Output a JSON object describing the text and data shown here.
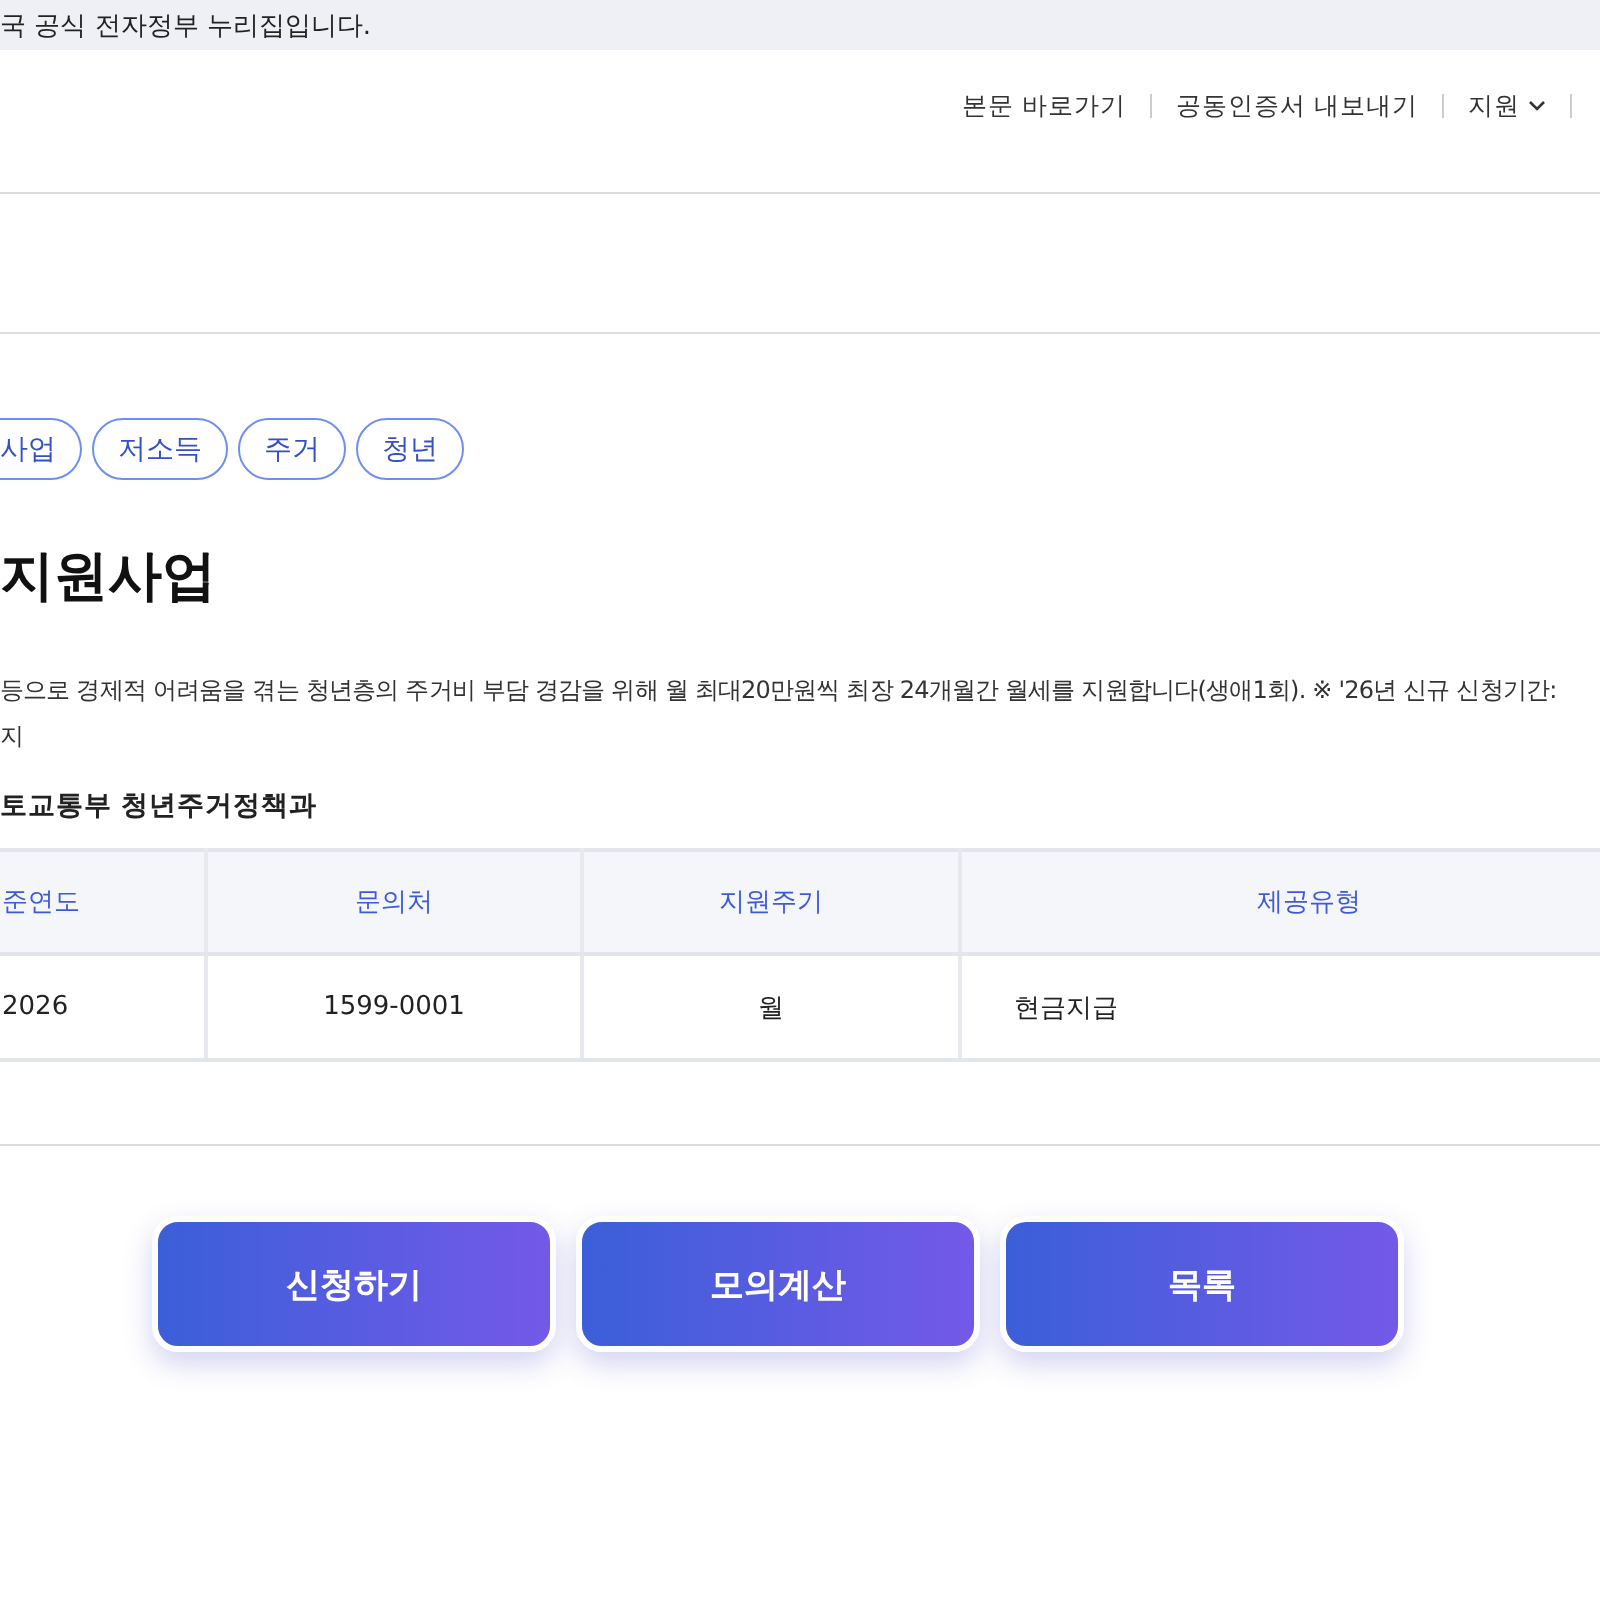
{
  "banner": {
    "text": "국 공식 전자정부 누리집입니다."
  },
  "utility_nav": [
    {
      "label": "본문 바로가기",
      "kind": "link"
    },
    {
      "label": "공동인증서 내보내기",
      "kind": "link"
    },
    {
      "label": "지원",
      "kind": "dropdown"
    }
  ],
  "tags": [
    "사업",
    "저소득",
    "주거",
    "청년"
  ],
  "title": "지원사업",
  "description": [
    "등으로 경제적 어려움을 겪는 청년층의 주거비 부담 경감을 위해 월 최대20만원씩 최장 24개월간 월세를 지원합니다(생애1회). ※ '26년 신규 신청기간:",
    "지"
  ],
  "agency": "토교통부 청년주거정책과",
  "table": {
    "columns": [
      "준연도",
      "문의처",
      "지원주기",
      "제공유형"
    ],
    "rows": [
      [
        "2026",
        "1599-0001",
        "월",
        "현금지급"
      ]
    ]
  },
  "buttons": [
    "신청하기",
    "모의계산",
    "목록"
  ]
}
